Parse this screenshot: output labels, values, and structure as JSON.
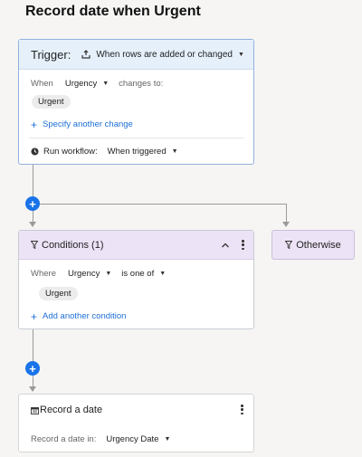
{
  "page": {
    "title": "Record date when Urgent"
  },
  "trigger": {
    "label": "Trigger:",
    "event": "When rows are added or changed",
    "when_label": "When",
    "when_field": "Urgency",
    "changes_to_label": "changes to:",
    "changes_to_value": "Urgent",
    "add_change_label": "Specify another change",
    "run_label": "Run workflow:",
    "run_value": "When triggered"
  },
  "conditions": {
    "title": "Conditions (1)",
    "where_label": "Where",
    "where_field": "Urgency",
    "operator": "is one of",
    "value": "Urgent",
    "add_condition_label": "Add another condition"
  },
  "otherwise": {
    "label": "Otherwise"
  },
  "action": {
    "title": "Record a date",
    "record_in_label": "Record a date in:",
    "record_in_value": "Urgency Date"
  },
  "icons": {
    "add": "plus-icon",
    "dropdown": "caret-down-icon",
    "kebab": "more-vertical-icon",
    "collapse": "chevron-up-icon",
    "filter": "filter-icon",
    "calendar": "calendar-icon",
    "clock": "clock-icon",
    "rows": "rows-changed-icon"
  },
  "colors": {
    "accent": "#1a73e8",
    "link": "#1d6fd6",
    "trigger_header": "#e5f0fb",
    "condition_header": "#ede3f6",
    "background": "#f6f5f4"
  }
}
